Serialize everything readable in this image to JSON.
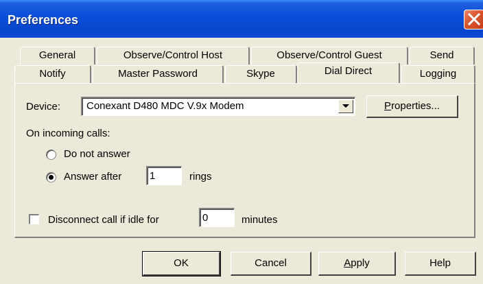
{
  "window": {
    "title": "Preferences"
  },
  "tabs": {
    "row1": [
      "General",
      "Observe/Control Host",
      "Observe/Control Guest",
      "Send"
    ],
    "row2": [
      "Notify",
      "Master Password",
      "Skype",
      "Dial Direct",
      "Logging"
    ],
    "active": "Dial Direct"
  },
  "device": {
    "label": "Device:",
    "value": "Conexant D480 MDC V.9x Modem",
    "properties_button": {
      "prefix": "P",
      "rest": "roperties..."
    }
  },
  "incoming": {
    "label": "On incoming calls:",
    "do_not_answer": "Do not answer",
    "answer_after": "Answer after",
    "rings_value": "1",
    "rings_label": "rings",
    "selected": "answer_after"
  },
  "disconnect": {
    "label": "Disconnect call if idle for",
    "minutes_value": "0",
    "minutes_label": "minutes",
    "checked": false
  },
  "buttons": {
    "ok": "OK",
    "cancel": "Cancel",
    "apply_prefix": "A",
    "apply_rest": "pply",
    "help": "Help"
  }
}
